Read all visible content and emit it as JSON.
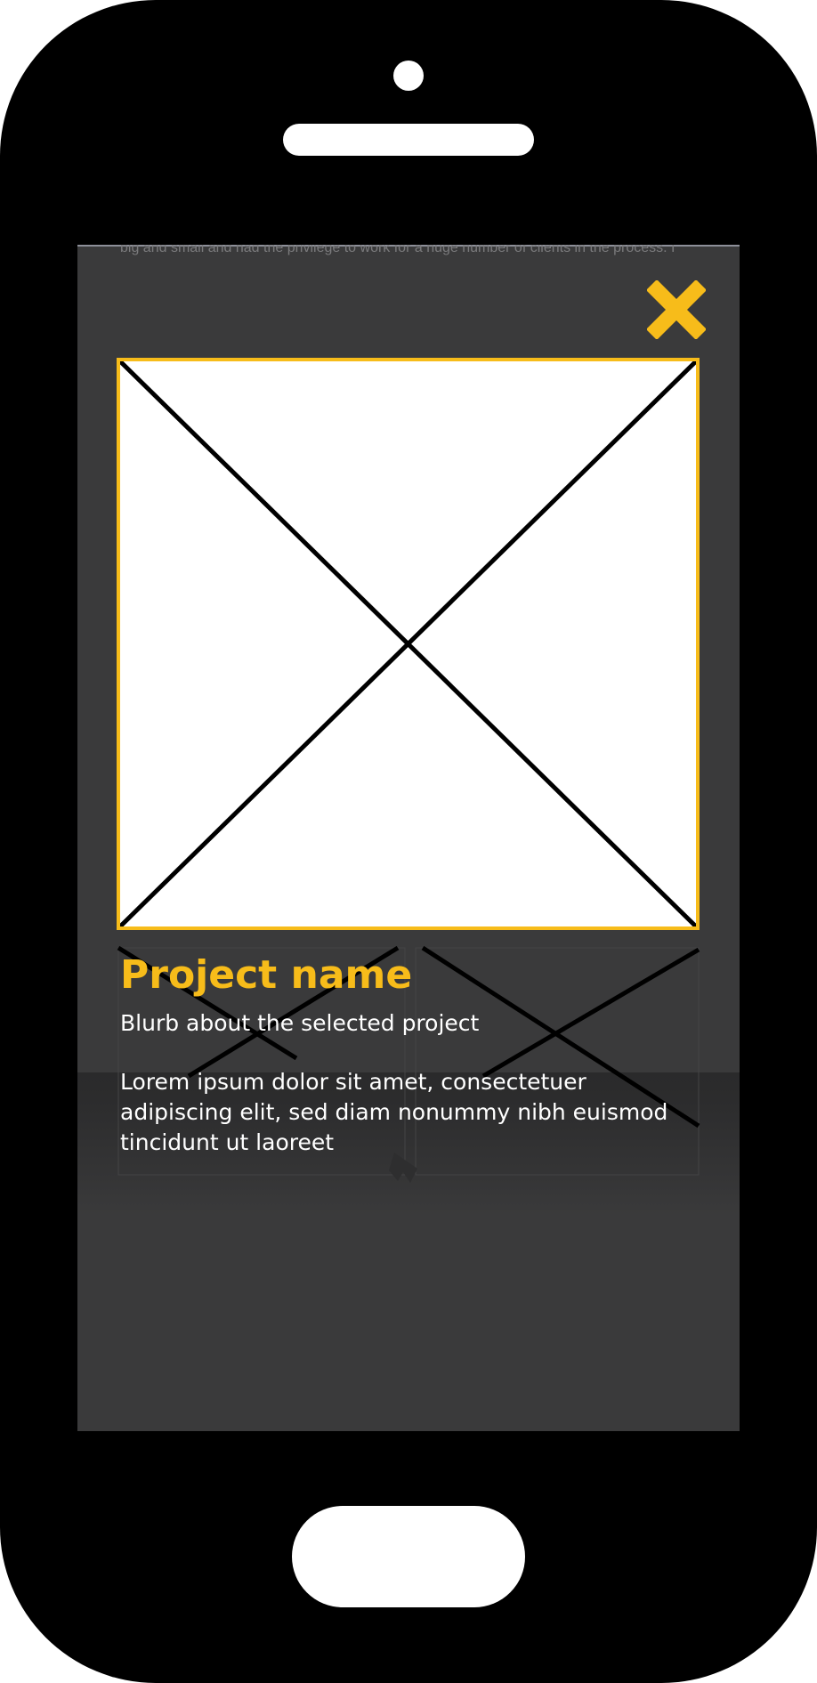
{
  "colors": {
    "accent": "#f7bc1a",
    "device": "#000000",
    "screen": "#3a3a3b",
    "placeholder": "#ffffff",
    "text": "#ffffff"
  },
  "background_page": {
    "partial_text": "big and small and had the privilege to work for a huge number of clients in the process. I"
  },
  "modal": {
    "close_icon": "close-icon",
    "image_placeholder": "image-placeholder",
    "project_title": "Project name",
    "project_blurb": "Blurb about the selected project",
    "project_body": "Lorem ipsum dolor sit amet, consectetuer adipiscing elit, sed diam nonummy nibh euismod tincidunt ut laoreet"
  }
}
